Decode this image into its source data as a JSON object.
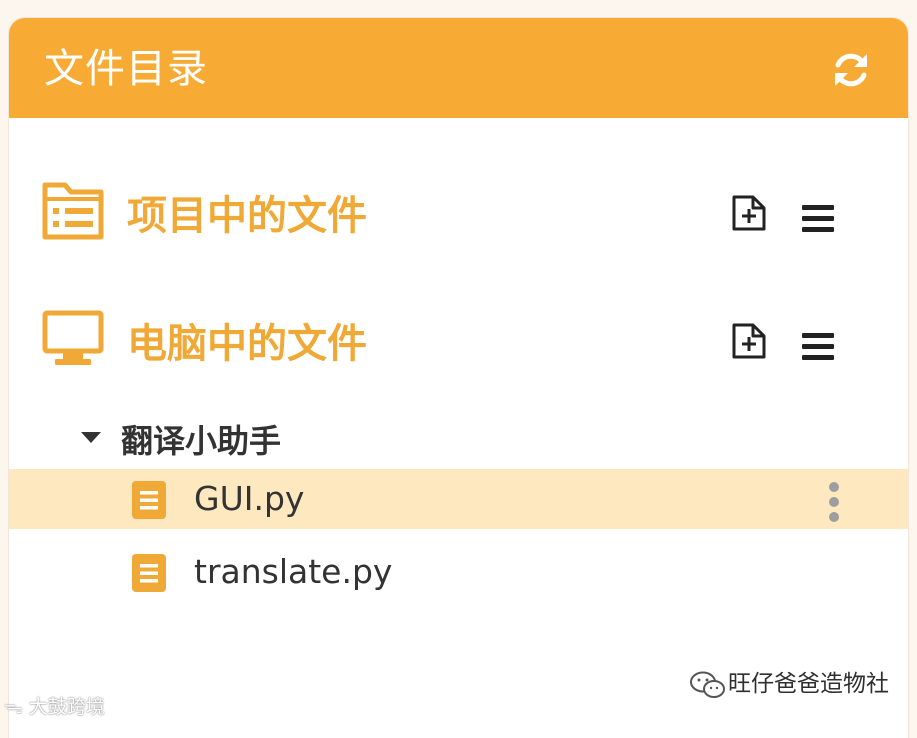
{
  "header": {
    "title": "文件目录",
    "refresh_icon": "refresh-icon"
  },
  "sections": [
    {
      "title": "项目中的文件",
      "icon": "folder-list-icon",
      "actions": [
        "new-file-icon",
        "menu-icon"
      ]
    },
    {
      "title": "电脑中的文件",
      "icon": "monitor-icon",
      "actions": [
        "new-file-icon",
        "menu-icon"
      ]
    }
  ],
  "tree": {
    "folder_name": "翻译小助手",
    "expanded": true,
    "files": [
      {
        "name": "GUI.py",
        "selected": true
      },
      {
        "name": "translate.py",
        "selected": false
      }
    ]
  },
  "watermarks": {
    "right": "旺仔爸爸造物社",
    "left": "大鼓跨境"
  },
  "colors": {
    "accent": "#f7ab35",
    "section_title": "#f0a937",
    "selected_row": "#fde8bf",
    "text": "#333333"
  }
}
